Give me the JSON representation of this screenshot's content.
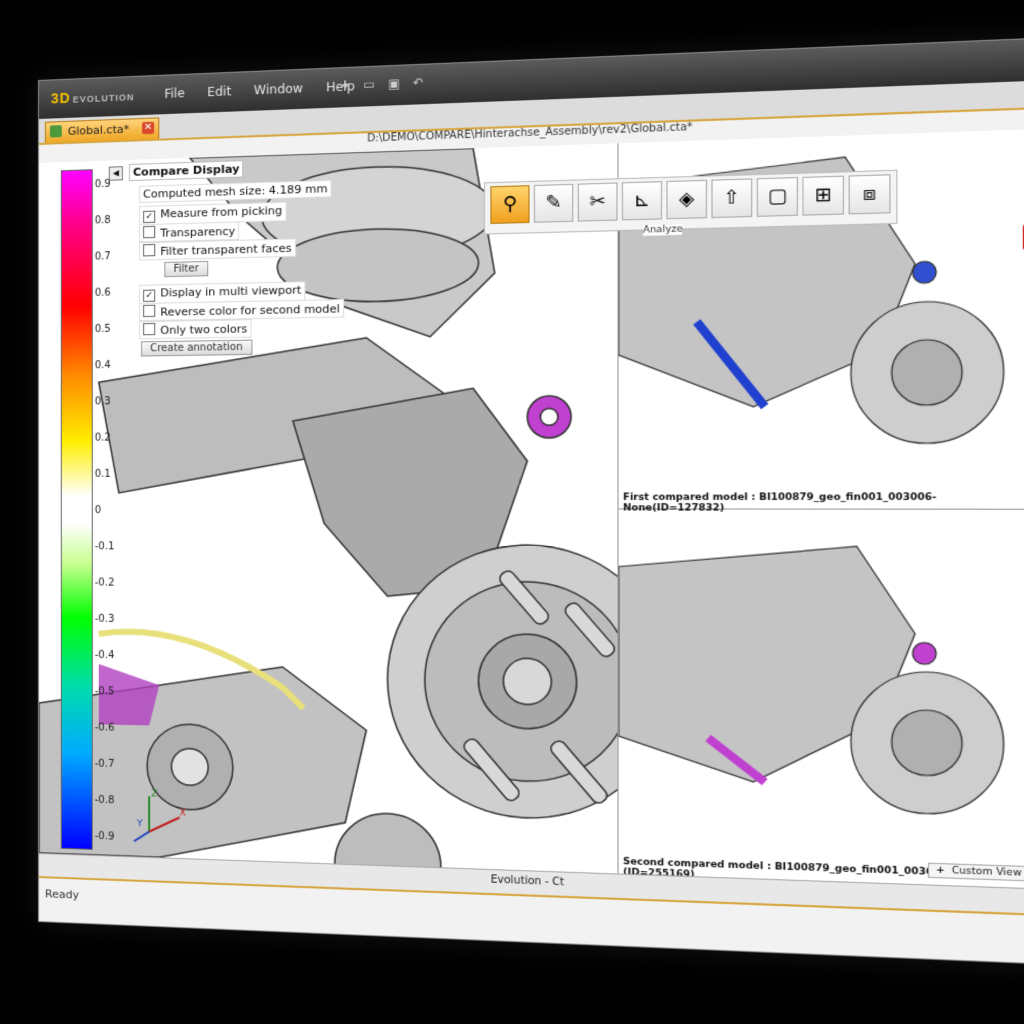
{
  "app": {
    "logo_main": "3D",
    "logo_sub": "EVOLUTION",
    "menu": [
      "File",
      "Edit",
      "Window",
      "Help"
    ],
    "document_tab": "Global.cta*",
    "path": "D:\\DEMO\\COMPARE\\Hinterachse_Assembly\\rev2\\Global.cta*",
    "bottom_title": "Evolution - Ct",
    "status": "Ready"
  },
  "compare_panel": {
    "title": "Compare Display",
    "mesh_size": "Computed mesh size: 4.189 mm",
    "options": [
      {
        "label": "Measure from picking",
        "checked": true
      },
      {
        "label": "Transparency",
        "checked": false
      },
      {
        "label": "Filter transparent faces",
        "checked": false
      }
    ],
    "filter_button": "Filter",
    "options2": [
      {
        "label": "Display in multi viewport",
        "checked": true
      },
      {
        "label": "Reverse color for second model",
        "checked": false
      },
      {
        "label": "Only two colors",
        "checked": false
      }
    ],
    "create_annotation": "Create annotation"
  },
  "colorbar": {
    "ticks": [
      "0.9",
      "0.8",
      "0.7",
      "0.6",
      "0.5",
      "0.4",
      "0.3",
      "0.2",
      "0.1",
      "0",
      "-0.1",
      "-0.2",
      "-0.3",
      "-0.4",
      "-0.5",
      "-0.6",
      "-0.7",
      "-0.8",
      "-0.9"
    ]
  },
  "toolbar": {
    "tooltip": "Analyze",
    "buttons": [
      "search-icon",
      "edit-icon",
      "tools-icon",
      "measure-icon",
      "box-icon",
      "upload-icon",
      "frame-icon",
      "grid-icon",
      "kit-icon"
    ]
  },
  "viewports": {
    "first_caption": "First compared model : BI100879_geo_fin001_003006-None(ID=127832)",
    "second_caption": "Second compared model : BI100879_geo_fin001_003006-None(2)(ID=255169)",
    "custom_view": "Custom View"
  },
  "axes": {
    "x": "X",
    "y": "Y",
    "z": "Z"
  }
}
